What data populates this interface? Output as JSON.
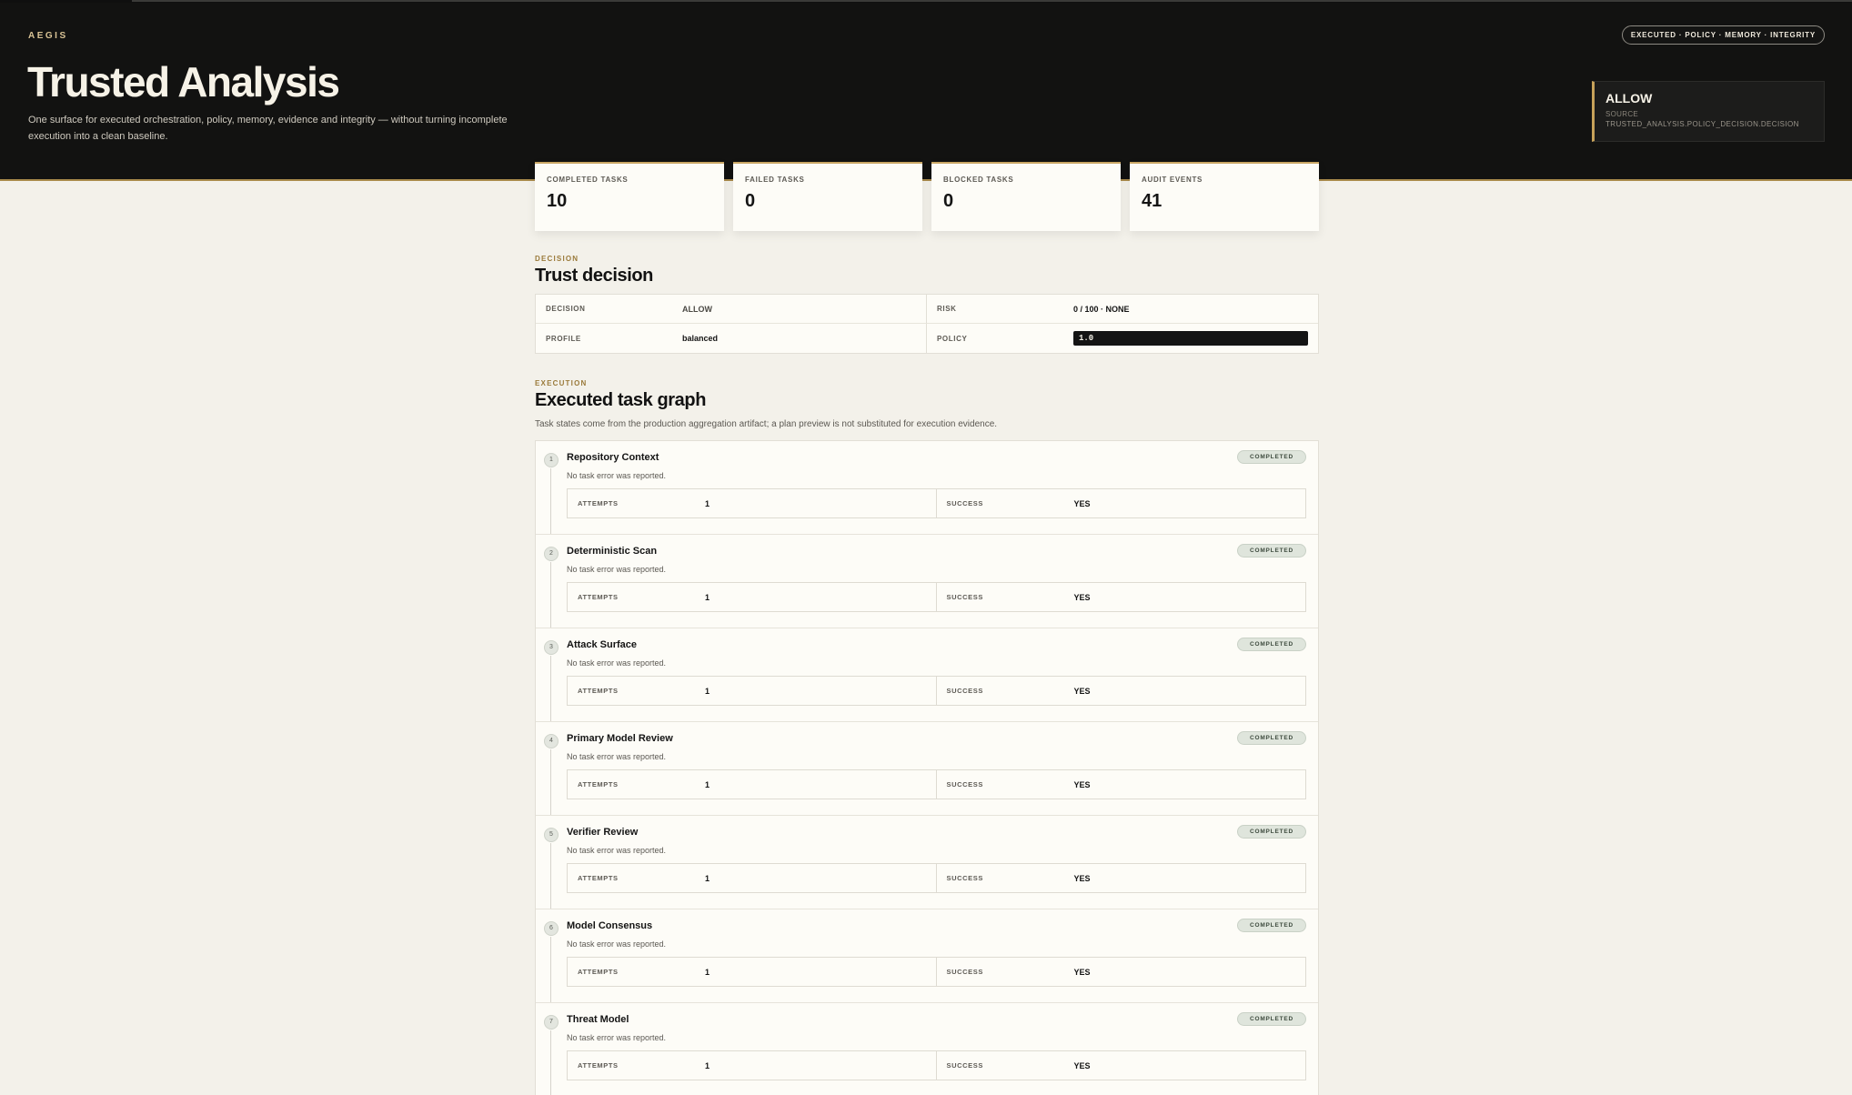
{
  "app": {
    "brand": "AEGIS",
    "title": "Trusted Analysis",
    "subtitle": "One surface for executed orchestration, policy, memory, evidence and integrity — without turning incomplete execution into a clean baseline.",
    "chip": "EXECUTED · POLICY · MEMORY · INTEGRITY"
  },
  "decision_card": {
    "value": "ALLOW",
    "source_label": "SOURCE",
    "source": "TRUSTED_ANALYSIS.POLICY_DECISION.DECISION"
  },
  "stats": [
    {
      "label": "COMPLETED TASKS",
      "value": "10"
    },
    {
      "label": "FAILED TASKS",
      "value": "0"
    },
    {
      "label": "BLOCKED TASKS",
      "value": "0"
    },
    {
      "label": "AUDIT EVENTS",
      "value": "41"
    }
  ],
  "trust_section": {
    "eyebrow": "DECISION",
    "title": "Trust decision",
    "fields": [
      {
        "key": "DECISION",
        "value": "ALLOW"
      },
      {
        "key": "RISK",
        "value": "0 / 100 · NONE"
      },
      {
        "key": "PROFILE",
        "value": "balanced"
      },
      {
        "key": "POLICY",
        "value": "1.0"
      }
    ]
  },
  "execution_section": {
    "eyebrow": "EXECUTION",
    "title": "Executed task graph",
    "description": "Task states come from the production aggregation artifact; a plan preview is not substituted for execution evidence.",
    "attempts_label": "ATTEMPTS",
    "success_label": "SUCCESS",
    "tasks": [
      {
        "num": "1",
        "name": "Repository Context",
        "status": "COMPLETED",
        "message": "No task error was reported.",
        "attempts": "1",
        "success": "YES"
      },
      {
        "num": "2",
        "name": "Deterministic Scan",
        "status": "COMPLETED",
        "message": "No task error was reported.",
        "attempts": "1",
        "success": "YES"
      },
      {
        "num": "3",
        "name": "Attack Surface",
        "status": "COMPLETED",
        "message": "No task error was reported.",
        "attempts": "1",
        "success": "YES"
      },
      {
        "num": "4",
        "name": "Primary Model Review",
        "status": "COMPLETED",
        "message": "No task error was reported.",
        "attempts": "1",
        "success": "YES"
      },
      {
        "num": "5",
        "name": "Verifier Review",
        "status": "COMPLETED",
        "message": "No task error was reported.",
        "attempts": "1",
        "success": "YES"
      },
      {
        "num": "6",
        "name": "Model Consensus",
        "status": "COMPLETED",
        "message": "No task error was reported.",
        "attempts": "1",
        "success": "YES"
      },
      {
        "num": "7",
        "name": "Threat Model",
        "status": "COMPLETED",
        "message": "No task error was reported.",
        "attempts": "1",
        "success": "YES"
      }
    ]
  }
}
